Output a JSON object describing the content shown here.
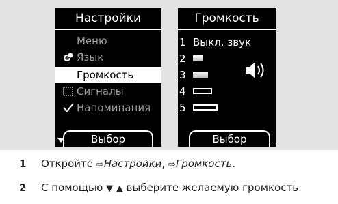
{
  "settings_screen": {
    "title": "Настройки",
    "items": [
      {
        "label": "Меню",
        "icon": "",
        "state": "dim"
      },
      {
        "label": "Язык",
        "icon": "language-icon",
        "state": "dim"
      },
      {
        "label": "Громкость",
        "icon": "",
        "state": "selected"
      },
      {
        "label": "Сигналы",
        "icon": "signals-icon",
        "state": "dim"
      },
      {
        "label": "Напоминания",
        "icon": "checkmark-icon",
        "state": "dim"
      }
    ],
    "softkey_label": "Выбор"
  },
  "volume_screen": {
    "title": "Громкость",
    "levels": [
      {
        "number": "1",
        "label": "Выкл. звук",
        "fill": 0
      },
      {
        "number": "2",
        "label": "",
        "fill": 0.2
      },
      {
        "number": "3",
        "label": "",
        "fill": 0.4
      },
      {
        "number": "4",
        "label": "",
        "fill": 0.6
      },
      {
        "number": "5",
        "label": "",
        "fill": 0.8
      }
    ],
    "softkey_label": "Выбор"
  },
  "instructions": [
    {
      "number": "1",
      "prefix": "Откройте ",
      "arrow": "⇨",
      "path1": "Настройки",
      "sep": ", ",
      "path2": "Громкость",
      "suffix": "."
    },
    {
      "number": "2",
      "prefix": "С помощью ",
      "down": "▼",
      "up": "▲",
      "suffix": " выберите желаемую громкость."
    }
  ]
}
